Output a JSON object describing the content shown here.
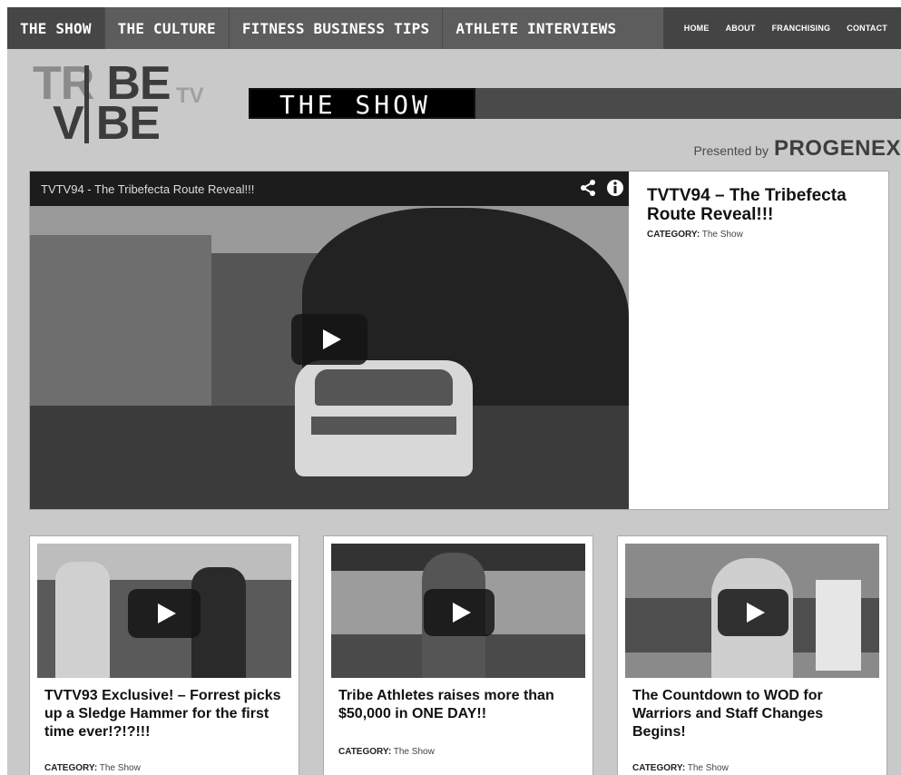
{
  "nav": {
    "main": [
      "THE SHOW",
      "THE CULTURE",
      "FITNESS BUSINESS TIPS",
      "ATHLETE INTERVIEWS"
    ],
    "active_index": 0,
    "utility": [
      "HOME",
      "ABOUT",
      "FRANCHISING",
      "CONTACT"
    ]
  },
  "logo": {
    "line1_prefix": "TR",
    "line1_suffix": "BE",
    "line2_prefix": "V",
    "line2_suffix": "BE",
    "tv": "TV"
  },
  "banner": {
    "title": "THE SHOW"
  },
  "sponsor": {
    "presented_by": "Presented by",
    "brand": "PROGENEX"
  },
  "featured": {
    "video_title": "TVTV94 - The Tribefecta Route Reveal!!!",
    "title": "TVTV94 – The Tribefecta Route Reveal!!!",
    "category_label": "CATEGORY:",
    "category": "The Show",
    "icons": [
      "share-icon",
      "info-icon",
      "play-icon"
    ]
  },
  "cards": [
    {
      "title": "TVTV93 Exclusive! – Forrest picks up a Sledge Hammer for the first time ever!?!?!!!",
      "category_label": "CATEGORY:",
      "category": "The Show"
    },
    {
      "title": "Tribe Athletes raises more than $50,000 in ONE DAY!!",
      "category_label": "CATEGORY:",
      "category": "The Show"
    },
    {
      "title": "The Countdown to WOD for Warriors and Staff Changes Begins!",
      "category_label": "CATEGORY:",
      "category": "The Show"
    }
  ],
  "colors": {
    "nav_bg": "#5d5d5d",
    "nav_active": "#464646",
    "page_bg": "#c9c9c9",
    "text": "#111111"
  }
}
